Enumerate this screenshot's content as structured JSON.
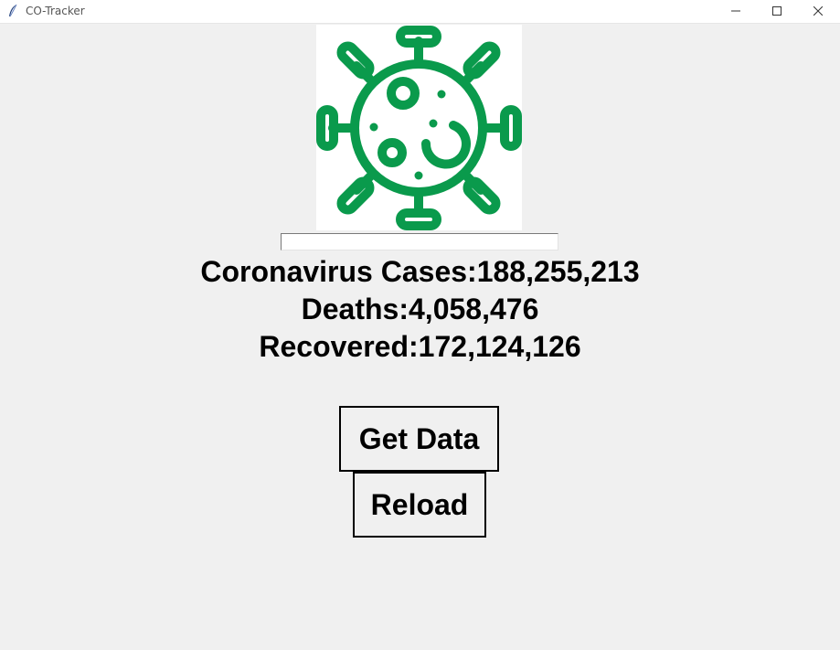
{
  "window": {
    "title": "CO-Tracker",
    "app_icon": "feather-icon",
    "controls": [
      "minimize-icon",
      "maximize-icon",
      "close-icon"
    ]
  },
  "logo": {
    "icon": "virus-icon",
    "color": "#0a9a4c"
  },
  "entry": {
    "value": ""
  },
  "stats": {
    "cases": "Coronavirus Cases:188,255,213",
    "deaths": "Deaths:4,058,476",
    "recovered": "Recovered:172,124,126"
  },
  "buttons": {
    "get_data": "Get Data",
    "reload": "Reload"
  }
}
